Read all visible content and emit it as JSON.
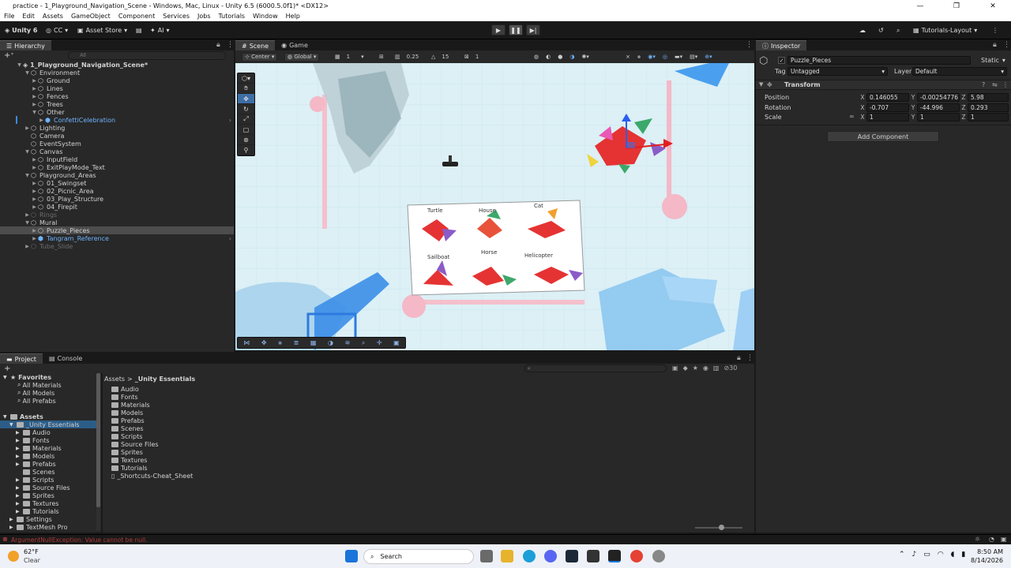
{
  "window": {
    "title": "practice - 1_Playground_Navigation_Scene - Windows, Mac, Linux - Unity 6.5 (6000.5.0f1)* <DX12>"
  },
  "menu": [
    "File",
    "Edit",
    "Assets",
    "GameObject",
    "Component",
    "Services",
    "Jobs",
    "Tutorials",
    "Window",
    "Help"
  ],
  "toolbar": {
    "unity": "Unity 6",
    "account": "CC",
    "asset_store": "Asset Store",
    "ai": "AI",
    "layout": "Tutorials-Layout"
  },
  "hierarchy": {
    "tab": "Hierarchy",
    "search_placeholder": "All",
    "items": [
      {
        "label": "1_Playground_Navigation_Scene*"
      },
      {
        "label": "Environment"
      },
      {
        "label": "Ground"
      },
      {
        "label": "Lines"
      },
      {
        "label": "Fences"
      },
      {
        "label": "Trees"
      },
      {
        "label": "Other"
      },
      {
        "label": "ConfettiCelebration"
      },
      {
        "label": "Lighting"
      },
      {
        "label": "Camera"
      },
      {
        "label": "EventSystem"
      },
      {
        "label": "Canvas"
      },
      {
        "label": "InputField"
      },
      {
        "label": "ExitPlayMode_Text"
      },
      {
        "label": "Playground_Areas"
      },
      {
        "label": "01_Swingset"
      },
      {
        "label": "02_Picnic_Area"
      },
      {
        "label": "03_Play_Structure"
      },
      {
        "label": "04_Firepit"
      },
      {
        "label": "Rings"
      },
      {
        "label": "Mural"
      },
      {
        "label": "Puzzle_Pieces"
      },
      {
        "label": "Tangram_Reference"
      },
      {
        "label": "Tube_Slide"
      }
    ]
  },
  "scene": {
    "tabs": [
      "Scene",
      "Game"
    ],
    "pivot": "Center",
    "space": "Global",
    "grid_val": "1",
    "snap_val": "0.25",
    "angle_val": "15",
    "scale_val": "1",
    "mural": [
      "Turtle",
      "House",
      "Cat",
      "Sailboat",
      "Horse",
      "Helicopter"
    ]
  },
  "inspector": {
    "tab": "Inspector",
    "object_name": "Puzzle_Pieces",
    "static_label": "Static",
    "tag_label": "Tag",
    "tag_value": "Untagged",
    "layer_label": "Layer",
    "layer_value": "Default",
    "component": "Transform",
    "position_label": "Position",
    "rotation_label": "Rotation",
    "scale_label": "Scale",
    "axis_x": "X",
    "axis_y": "Y",
    "axis_z": "Z",
    "position": {
      "x": "0.146055",
      "y": "-0.00254776",
      "z": "5.98"
    },
    "rotation": {
      "x": "-0.707",
      "y": "-44.996",
      "z": "0.293"
    },
    "scale": {
      "x": "1",
      "y": "1",
      "z": "1"
    },
    "add_component": "Add Component"
  },
  "project": {
    "tabs": [
      "Project",
      "Console"
    ],
    "favorites_label": "Favorites",
    "favorites": [
      "All Materials",
      "All Models",
      "All Prefabs"
    ],
    "assets_label": "Assets",
    "tree": [
      "_Unity Essentials",
      "Audio",
      "Fonts",
      "Materials",
      "Models",
      "Prefabs",
      "Scenes",
      "Scripts",
      "Source Files",
      "Sprites",
      "Textures",
      "Tutorials",
      "Settings",
      "TextMesh Pro"
    ],
    "breadcrumb_root": "Assets",
    "breadcrumb_sep": ">",
    "breadcrumb_leaf": "_Unity Essentials",
    "folders": [
      "Audio",
      "Fonts",
      "Materials",
      "Models",
      "Prefabs",
      "Scenes",
      "Scripts",
      "Source Files",
      "Sprites",
      "Textures",
      "Tutorials"
    ],
    "file": "_Shortcuts-Cheat_Sheet",
    "count": "30"
  },
  "status": {
    "error": "ArgumentNullException: Value cannot be null."
  },
  "taskbar": {
    "temp": "62°F",
    "weather": "Clear",
    "search": "Search",
    "time": "8:50 AM",
    "date": "8/14/2026"
  },
  "colors": {
    "selection": "#2c5d87",
    "accent_blue": "#3e6ea5",
    "error_red": "#e25050"
  }
}
